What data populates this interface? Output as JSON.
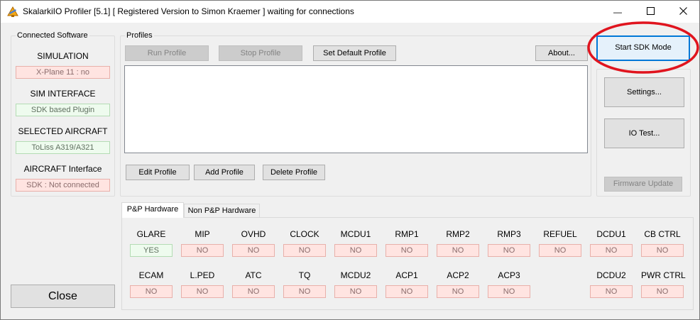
{
  "window": {
    "title": "SkalarkiIO Profiler [5.1] [ Registered Version to Simon Kraemer  ] waiting for connections",
    "minimize_glyph": "—",
    "maximize_glyph": "☐",
    "close_glyph": "✕"
  },
  "connected_software": {
    "label": "Connected Software",
    "simulation": {
      "label": "SIMULATION",
      "value": "X-Plane 11 : no",
      "status": "red"
    },
    "sim_interface": {
      "label": "SIM INTERFACE",
      "value": "SDK based Plugin",
      "status": "green"
    },
    "selected_aircraft": {
      "label": "SELECTED AIRCRAFT",
      "value": "ToLiss A319/A321",
      "status": "green"
    },
    "aircraft_interface": {
      "label": "AIRCRAFT Interface",
      "value": "SDK : Not connected",
      "status": "red"
    }
  },
  "profiles": {
    "label": "Profiles",
    "run_label": "Run Profile",
    "stop_label": "Stop Profile",
    "set_default_label": "Set Default Profile",
    "about_label": "About...",
    "edit_label": "Edit Profile",
    "add_label": "Add Profile",
    "delete_label": "Delete Profile"
  },
  "right_panel": {
    "start_sdk_label": "Start SDK Mode",
    "settings_label": "Settings...",
    "io_test_label": "IO Test...",
    "firmware_label": "Firmware Update"
  },
  "close_label": "Close",
  "tabs": [
    "P&P Hardware",
    "Non P&P Hardware"
  ],
  "hardware_row1": [
    {
      "label": "GLARE",
      "value": "YES",
      "status": "green"
    },
    {
      "label": "MIP",
      "value": "NO",
      "status": "red"
    },
    {
      "label": "OVHD",
      "value": "NO",
      "status": "red"
    },
    {
      "label": "CLOCK",
      "value": "NO",
      "status": "red"
    },
    {
      "label": "MCDU1",
      "value": "NO",
      "status": "red"
    },
    {
      "label": "RMP1",
      "value": "NO",
      "status": "red"
    },
    {
      "label": "RMP2",
      "value": "NO",
      "status": "red"
    },
    {
      "label": "RMP3",
      "value": "NO",
      "status": "red"
    },
    {
      "label": "REFUEL",
      "value": "NO",
      "status": "red"
    },
    {
      "label": "DCDU1",
      "value": "NO",
      "status": "red"
    },
    {
      "label": "CB CTRL",
      "value": "NO",
      "status": "red"
    }
  ],
  "hardware_row2": [
    {
      "label": "ECAM",
      "value": "NO",
      "status": "red"
    },
    {
      "label": "L.PED",
      "value": "NO",
      "status": "red"
    },
    {
      "label": "ATC",
      "value": "NO",
      "status": "red"
    },
    {
      "label": "TQ",
      "value": "NO",
      "status": "red"
    },
    {
      "label": "MCDU2",
      "value": "NO",
      "status": "red"
    },
    {
      "label": "ACP1",
      "value": "NO",
      "status": "red"
    },
    {
      "label": "ACP2",
      "value": "NO",
      "status": "red"
    },
    {
      "label": "ACP3",
      "value": "NO",
      "status": "red"
    },
    {
      "label": "DCDU2",
      "value": "NO",
      "status": "red"
    },
    {
      "label": "PWR CTRL",
      "value": "NO",
      "status": "red"
    }
  ],
  "colors": {
    "status_red_bg": "#ffe4e1",
    "status_green_bg": "#eefbee",
    "annotation_ring": "#e0141e",
    "focus_blue": "#0078d7"
  }
}
